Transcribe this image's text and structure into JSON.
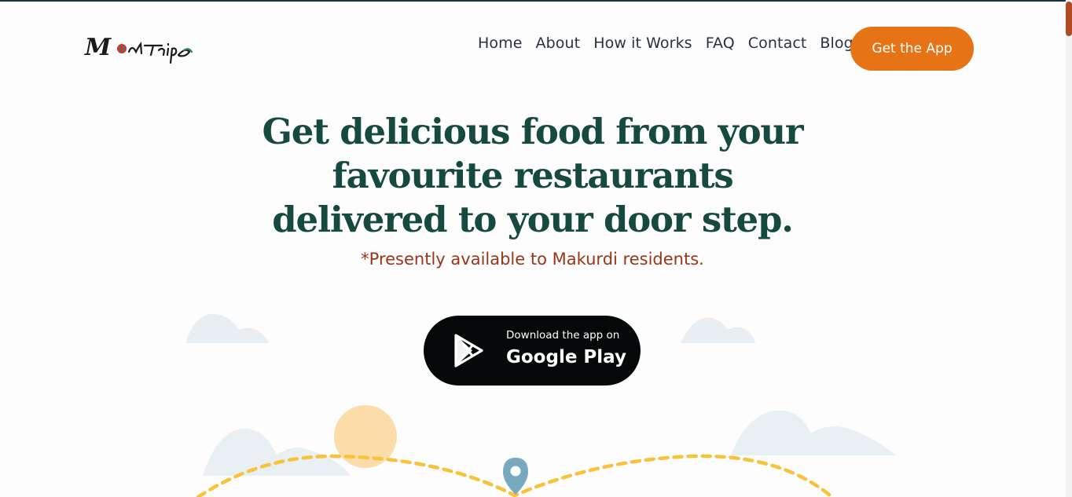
{
  "brand": {
    "logo_text": "MealTrips"
  },
  "nav": {
    "items": [
      {
        "label": "Home"
      },
      {
        "label": "About"
      },
      {
        "label": "How it Works"
      },
      {
        "label": "FAQ"
      },
      {
        "label": "Contact"
      },
      {
        "label": "Blog"
      }
    ],
    "cta_label": "Get the App"
  },
  "hero": {
    "title_lines": [
      "Get delicious food from your",
      "favourite restaurants",
      "delivered to your door step."
    ],
    "note": "*Presently available to Makurdi residents."
  },
  "download": {
    "small_text": "Download the app on",
    "big_text": "Google Play"
  },
  "icons": {
    "play_store": "google-play-icon",
    "location": "map-pin-icon"
  },
  "colors": {
    "accent": "#e77317",
    "heading": "#164a40",
    "note": "#9b3518",
    "nav_text": "#27323e",
    "route": "#f8c33b",
    "pin": "#79a9bf",
    "sun": "#fcd9a0"
  }
}
